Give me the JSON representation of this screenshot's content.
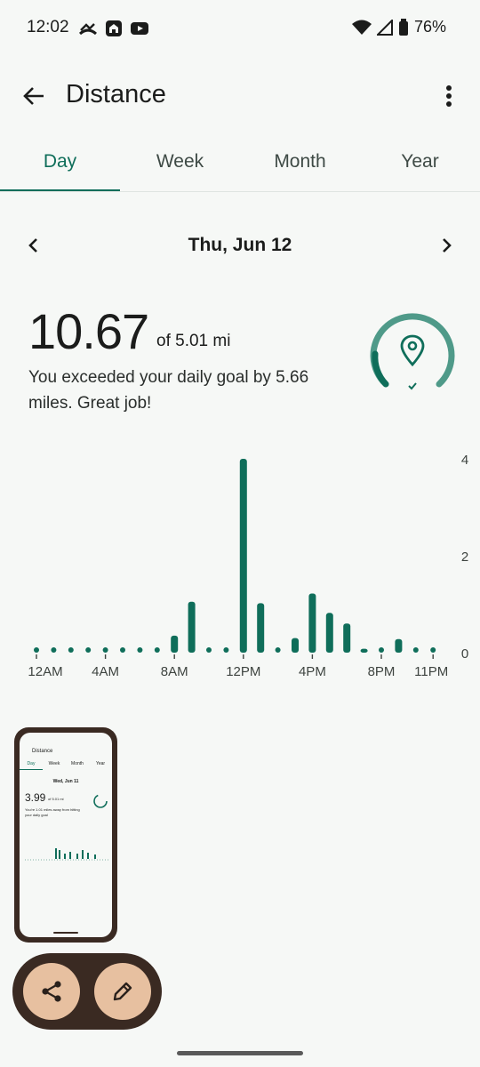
{
  "status_bar": {
    "time": "12:02",
    "battery": "76%"
  },
  "app_bar": {
    "title": "Distance"
  },
  "tabs": [
    {
      "label": "Day",
      "active": true
    },
    {
      "label": "Week",
      "active": false
    },
    {
      "label": "Month",
      "active": false
    },
    {
      "label": "Year",
      "active": false
    }
  ],
  "date_nav": {
    "date": "Thu, Jun 12"
  },
  "summary": {
    "value": "10.67",
    "goal_text": "of 5.01 mi",
    "message": "You exceeded your daily goal by 5.66 miles. Great job!",
    "goal_progress": 1.0
  },
  "colors": {
    "accent": "#0f6e5a",
    "ring_light": "#4f9a89",
    "fab": "#e7c0a0",
    "dark": "#3a2a22"
  },
  "chart_data": {
    "type": "bar",
    "x_tick_labels": [
      "12AM",
      "4AM",
      "8AM",
      "12PM",
      "4PM",
      "8PM",
      "11PM"
    ],
    "y_tick_labels": [
      "4",
      "2",
      "0"
    ],
    "ylim": [
      0,
      4
    ],
    "categories": [
      "12AM",
      "1AM",
      "2AM",
      "3AM",
      "4AM",
      "5AM",
      "6AM",
      "7AM",
      "8AM",
      "9AM",
      "10AM",
      "11AM",
      "12PM",
      "1PM",
      "2PM",
      "3PM",
      "4PM",
      "5PM",
      "6PM",
      "7PM",
      "8PM",
      "9PM",
      "10PM",
      "11PM"
    ],
    "values": [
      0,
      0,
      0,
      0,
      0,
      0,
      0,
      0,
      0.35,
      1.05,
      0.05,
      0,
      4.0,
      1.02,
      0,
      0.3,
      1.22,
      0.82,
      0.6,
      0.08,
      0.05,
      0.28,
      0.03,
      0
    ]
  },
  "preview": {
    "title": "Distance",
    "tabs": [
      "Day",
      "Week",
      "Month",
      "Year"
    ],
    "date": "Wed, Jun 11",
    "value": "3.99",
    "goal_text": "of 5.01 mi",
    "message": "You're 1.01 miles away from hitting your daily goal"
  },
  "actions": {
    "share_icon": "share-icon",
    "edit_icon": "edit-icon"
  }
}
